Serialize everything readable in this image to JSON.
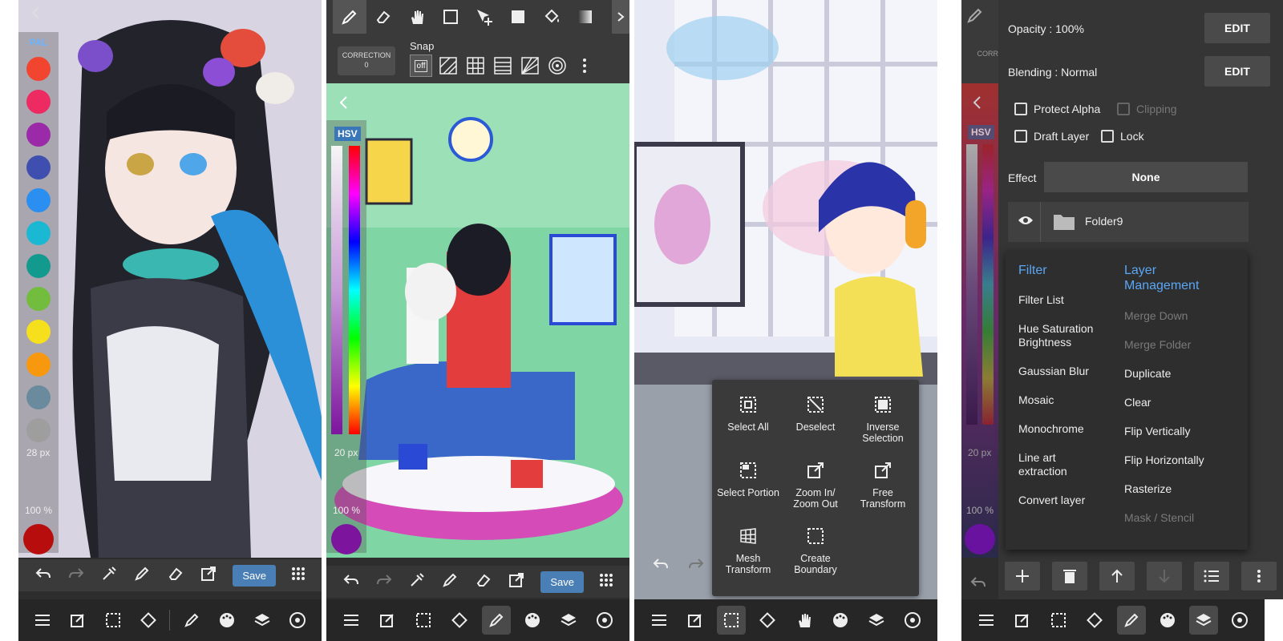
{
  "panel1": {
    "palette_tab": "PAL",
    "brush_size": "28 px",
    "opacity": "100 %",
    "save_label": "Save",
    "palette_colors": [
      "#f2452f",
      "#ee2a62",
      "#9b2aa8",
      "#3e4fb0",
      "#2a8ff0",
      "#1ab8d3",
      "#129a8f",
      "#72bd3e",
      "#f6e01e",
      "#f7980f",
      "#6a8a9e",
      "#9e9e9e"
    ],
    "current_color": "#b80d0d"
  },
  "panel2": {
    "correction_label": "CORRECTION",
    "correction_value": "0",
    "snap_title": "Snap",
    "snap_off": "off",
    "hsv_label": "HSV",
    "brush_size": "20 px",
    "opacity": "100 %",
    "save_label": "Save",
    "current_color": "#7d149e"
  },
  "panel3": {
    "selection_menu": {
      "items": [
        "Select All",
        "Deselect",
        "Inverse Selection",
        "Select Portion",
        "Zoom In/ Zoom Out",
        "Free Transform",
        "Mesh Transform",
        "Create Boundary"
      ]
    }
  },
  "panel4": {
    "opacity_label": "Opacity : 100%",
    "blending_label": "Blending : Normal",
    "edit_label": "EDIT",
    "protect_alpha": "Protect Alpha",
    "clipping": "Clipping",
    "draft_layer": "Draft Layer",
    "lock": "Lock",
    "effect_label": "Effect",
    "effect_value": "None",
    "folder_name": "Folder9",
    "hsv_label": "HSV",
    "brush_size": "20 px",
    "opacity": "100 %",
    "corr_partial": "CORR",
    "current_color": "#6a12a0",
    "filter_menu": {
      "heading": "Filter",
      "items": [
        "Filter List",
        "Hue Saturation Brightness",
        "Gaussian Blur",
        "Mosaic",
        "Monochrome",
        "Line art extraction",
        "Convert layer"
      ]
    },
    "layer_menu": {
      "heading": "Layer Management",
      "items": [
        "Merge Down",
        "Merge Folder",
        "Duplicate",
        "Clear",
        "Flip Vertically",
        "Flip Horizontally",
        "Rasterize",
        "Mask / Stencil"
      ],
      "disabled": [
        "Merge Down",
        "Merge Folder",
        "Mask / Stencil"
      ]
    }
  }
}
